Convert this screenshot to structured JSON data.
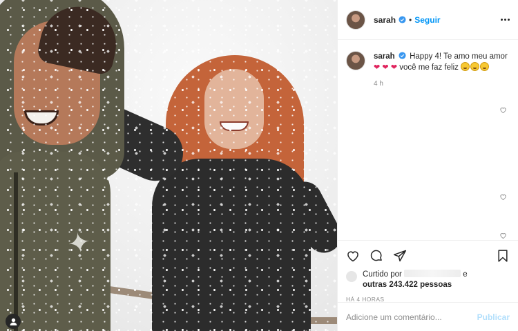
{
  "post": {
    "author": {
      "username": "sarah",
      "verified": true,
      "follow_label": "Seguir",
      "separator": "•"
    },
    "caption": {
      "username": "sarah",
      "text": "Happy 4! Te amo meu amor",
      "line2": "você me faz feliz",
      "hearts_count": 3,
      "emoji_count": 3,
      "time": "4 h"
    },
    "likes": {
      "prefix": "Curtido por",
      "suffix": "e",
      "others": "outras 243.422 pessoas"
    },
    "posted_ago": "HÁ 4 HORAS",
    "comment_input": {
      "placeholder": "Adicione um comentário...",
      "submit_label": "Publicar"
    }
  },
  "colors": {
    "accent_blue": "#0095f6",
    "publish_disabled": "#b2dffc",
    "heart_red": "#e0245e",
    "muted": "#8e8e8e"
  },
  "icons": {
    "like": "heart-icon",
    "comment": "comment-icon",
    "share": "send-icon",
    "save": "bookmark-icon",
    "more": "more-icon",
    "tags": "user-tag-icon"
  }
}
